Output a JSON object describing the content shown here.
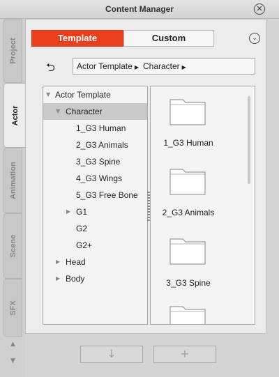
{
  "window": {
    "title": "Content Manager",
    "close_icon": "close-circle-icon"
  },
  "side_tabs": [
    "Project",
    "Actor",
    "Animation",
    "Scene",
    "SFX"
  ],
  "active_side_tab": "Actor",
  "segments": {
    "template": "Template",
    "custom": "Custom",
    "active": "Template"
  },
  "colors": {
    "accent": "#e8401c"
  },
  "breadcrumb": [
    "Actor Template",
    "Character"
  ],
  "tree": {
    "items": [
      {
        "label": "Actor Template",
        "expanded": true
      },
      {
        "label": "Character",
        "expanded": true,
        "selected": true
      },
      {
        "label": "1_G3 Human"
      },
      {
        "label": "2_G3 Animals"
      },
      {
        "label": "3_G3 Spine"
      },
      {
        "label": "4_G3 Wings"
      },
      {
        "label": "5_G3 Free Bone"
      },
      {
        "label": "G1",
        "expandable": true
      },
      {
        "label": "G2"
      },
      {
        "label": "G2+"
      },
      {
        "label": "Head",
        "expandable": true
      },
      {
        "label": "Body",
        "expandable": true
      }
    ]
  },
  "grid": {
    "items": [
      {
        "label": "1_G3 Human"
      },
      {
        "label": "2_G3 Animals"
      },
      {
        "label": "3_G3 Spine"
      },
      {
        "label": ""
      }
    ]
  },
  "bottom_buttons": [
    {
      "icon": "down-arrow-icon"
    },
    {
      "icon": "plus-icon"
    }
  ]
}
